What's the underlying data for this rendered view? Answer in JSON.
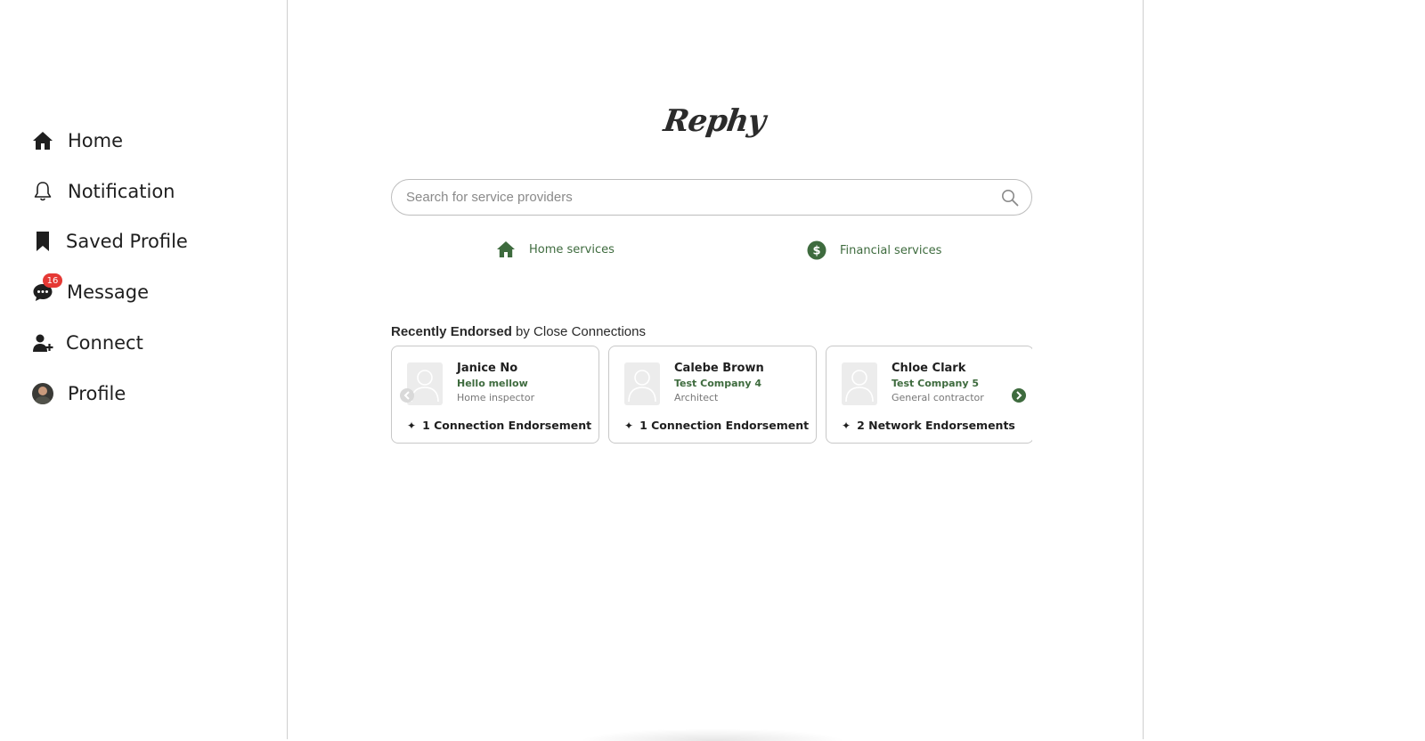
{
  "sidebar": {
    "items": [
      {
        "label": "Home",
        "icon": "home-icon"
      },
      {
        "label": "Notification",
        "icon": "bell-icon"
      },
      {
        "label": "Saved Profile",
        "icon": "bookmark-icon"
      },
      {
        "label": "Message",
        "icon": "chat-icon",
        "badge": "16"
      },
      {
        "label": "Connect",
        "icon": "add-user-icon"
      },
      {
        "label": "Profile",
        "icon": "avatar"
      }
    ]
  },
  "logo": {
    "text": "Rephy"
  },
  "search": {
    "placeholder": "Search for service providers",
    "value": ""
  },
  "categories": [
    {
      "label": "Home services",
      "icon": "house-icon"
    },
    {
      "label": "Financial services",
      "icon": "dollar-circle-icon"
    }
  ],
  "recently": {
    "title_bold": "Recently Endorsed",
    "title_rest": " by Close Connections"
  },
  "cards": [
    {
      "name": "Janice No",
      "company": "Hello mellow",
      "role": "Home inspector",
      "endorsement": "1 Connection Endorsement"
    },
    {
      "name": "Calebe Brown",
      "company": "Test Company 4",
      "role": "Architect",
      "endorsement": "1 Connection Endorsement"
    },
    {
      "name": "Chloe Clark",
      "company": "Test Company 5",
      "role": "General contractor",
      "endorsement": "2 Network Endorsements"
    }
  ],
  "colors": {
    "accent": "#3e6b3e",
    "badge": "#e53935",
    "border": "#c8c8c8"
  }
}
